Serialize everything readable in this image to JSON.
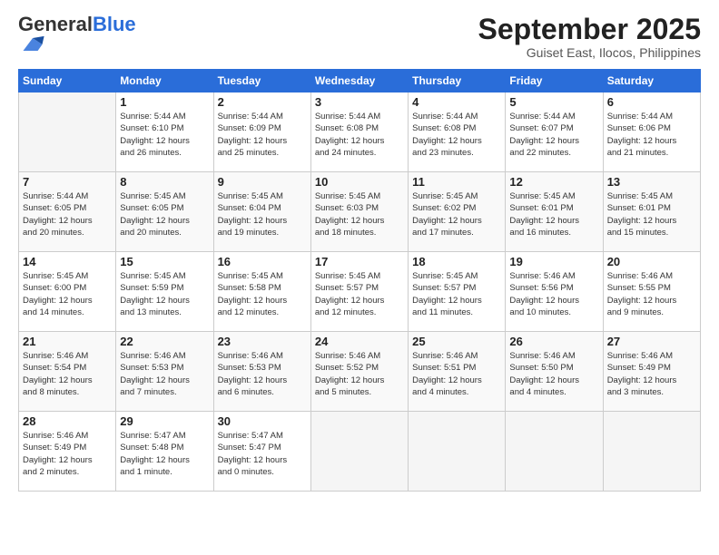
{
  "header": {
    "logo_general": "General",
    "logo_blue": "Blue",
    "month_title": "September 2025",
    "location": "Guiset East, Ilocos, Philippines"
  },
  "weekdays": [
    "Sunday",
    "Monday",
    "Tuesday",
    "Wednesday",
    "Thursday",
    "Friday",
    "Saturday"
  ],
  "weeks": [
    [
      {
        "day": "",
        "info": ""
      },
      {
        "day": "1",
        "info": "Sunrise: 5:44 AM\nSunset: 6:10 PM\nDaylight: 12 hours\nand 26 minutes."
      },
      {
        "day": "2",
        "info": "Sunrise: 5:44 AM\nSunset: 6:09 PM\nDaylight: 12 hours\nand 25 minutes."
      },
      {
        "day": "3",
        "info": "Sunrise: 5:44 AM\nSunset: 6:08 PM\nDaylight: 12 hours\nand 24 minutes."
      },
      {
        "day": "4",
        "info": "Sunrise: 5:44 AM\nSunset: 6:08 PM\nDaylight: 12 hours\nand 23 minutes."
      },
      {
        "day": "5",
        "info": "Sunrise: 5:44 AM\nSunset: 6:07 PM\nDaylight: 12 hours\nand 22 minutes."
      },
      {
        "day": "6",
        "info": "Sunrise: 5:44 AM\nSunset: 6:06 PM\nDaylight: 12 hours\nand 21 minutes."
      }
    ],
    [
      {
        "day": "7",
        "info": "Sunrise: 5:44 AM\nSunset: 6:05 PM\nDaylight: 12 hours\nand 20 minutes."
      },
      {
        "day": "8",
        "info": "Sunrise: 5:45 AM\nSunset: 6:05 PM\nDaylight: 12 hours\nand 20 minutes."
      },
      {
        "day": "9",
        "info": "Sunrise: 5:45 AM\nSunset: 6:04 PM\nDaylight: 12 hours\nand 19 minutes."
      },
      {
        "day": "10",
        "info": "Sunrise: 5:45 AM\nSunset: 6:03 PM\nDaylight: 12 hours\nand 18 minutes."
      },
      {
        "day": "11",
        "info": "Sunrise: 5:45 AM\nSunset: 6:02 PM\nDaylight: 12 hours\nand 17 minutes."
      },
      {
        "day": "12",
        "info": "Sunrise: 5:45 AM\nSunset: 6:01 PM\nDaylight: 12 hours\nand 16 minutes."
      },
      {
        "day": "13",
        "info": "Sunrise: 5:45 AM\nSunset: 6:01 PM\nDaylight: 12 hours\nand 15 minutes."
      }
    ],
    [
      {
        "day": "14",
        "info": "Sunrise: 5:45 AM\nSunset: 6:00 PM\nDaylight: 12 hours\nand 14 minutes."
      },
      {
        "day": "15",
        "info": "Sunrise: 5:45 AM\nSunset: 5:59 PM\nDaylight: 12 hours\nand 13 minutes."
      },
      {
        "day": "16",
        "info": "Sunrise: 5:45 AM\nSunset: 5:58 PM\nDaylight: 12 hours\nand 12 minutes."
      },
      {
        "day": "17",
        "info": "Sunrise: 5:45 AM\nSunset: 5:57 PM\nDaylight: 12 hours\nand 12 minutes."
      },
      {
        "day": "18",
        "info": "Sunrise: 5:45 AM\nSunset: 5:57 PM\nDaylight: 12 hours\nand 11 minutes."
      },
      {
        "day": "19",
        "info": "Sunrise: 5:46 AM\nSunset: 5:56 PM\nDaylight: 12 hours\nand 10 minutes."
      },
      {
        "day": "20",
        "info": "Sunrise: 5:46 AM\nSunset: 5:55 PM\nDaylight: 12 hours\nand 9 minutes."
      }
    ],
    [
      {
        "day": "21",
        "info": "Sunrise: 5:46 AM\nSunset: 5:54 PM\nDaylight: 12 hours\nand 8 minutes."
      },
      {
        "day": "22",
        "info": "Sunrise: 5:46 AM\nSunset: 5:53 PM\nDaylight: 12 hours\nand 7 minutes."
      },
      {
        "day": "23",
        "info": "Sunrise: 5:46 AM\nSunset: 5:53 PM\nDaylight: 12 hours\nand 6 minutes."
      },
      {
        "day": "24",
        "info": "Sunrise: 5:46 AM\nSunset: 5:52 PM\nDaylight: 12 hours\nand 5 minutes."
      },
      {
        "day": "25",
        "info": "Sunrise: 5:46 AM\nSunset: 5:51 PM\nDaylight: 12 hours\nand 4 minutes."
      },
      {
        "day": "26",
        "info": "Sunrise: 5:46 AM\nSunset: 5:50 PM\nDaylight: 12 hours\nand 4 minutes."
      },
      {
        "day": "27",
        "info": "Sunrise: 5:46 AM\nSunset: 5:49 PM\nDaylight: 12 hours\nand 3 minutes."
      }
    ],
    [
      {
        "day": "28",
        "info": "Sunrise: 5:46 AM\nSunset: 5:49 PM\nDaylight: 12 hours\nand 2 minutes."
      },
      {
        "day": "29",
        "info": "Sunrise: 5:47 AM\nSunset: 5:48 PM\nDaylight: 12 hours\nand 1 minute."
      },
      {
        "day": "30",
        "info": "Sunrise: 5:47 AM\nSunset: 5:47 PM\nDaylight: 12 hours\nand 0 minutes."
      },
      {
        "day": "",
        "info": ""
      },
      {
        "day": "",
        "info": ""
      },
      {
        "day": "",
        "info": ""
      },
      {
        "day": "",
        "info": ""
      }
    ]
  ]
}
